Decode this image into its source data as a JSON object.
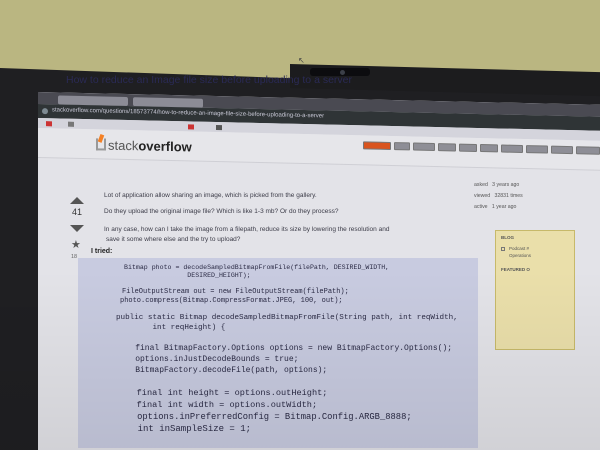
{
  "browser": {
    "url": "stackoverflow.com/questions/18573774/how-to-reduce-an-image-file-size-before-uploading-to-a-server"
  },
  "site": {
    "logo_prefix": "stack",
    "logo_suffix": "overflow"
  },
  "question": {
    "title": "How to reduce an Image file size before uploading to a server",
    "body_line_1": "Lot of application allow sharing an image, which is picked from the gallery.",
    "body_line_2": "Do they upload the original image file? Which is like 1-3 mb? Or do they process?",
    "body_line_3": "In any case, how can I take the image from a filepath, reduce its size by lowering the resolution and",
    "body_line_4": "save it some where else and the try to upload?",
    "tried_label": "I tried:",
    "votes": "41",
    "favorites": "18"
  },
  "meta": {
    "asked_label": "asked",
    "asked_value": "3 years ago",
    "viewed_label": "viewed",
    "viewed_value": "32831 times",
    "active_label": "active",
    "active_value": "1 year ago"
  },
  "code": [
    "Bitmap photo = decodeSampledBitmapFromFile(filePath, DESIRED_WIDTH,",
    "                DESIRED_HEIGHT);",
    "",
    "FileOutputStream out = new FileOutputStream(filePath);",
    "photo.compress(Bitmap.CompressFormat.JPEG, 100, out);",
    "",
    "public static Bitmap decodeSampledBitmapFromFile(String path, int reqWidth,",
    "        int reqHeight) {",
    "",
    "    final BitmapFactory.Options options = new BitmapFactory.Options();",
    "    options.inJustDecodeBounds = true;",
    "    BitmapFactory.decodeFile(path, options);",
    "",
    "    final int height = options.outHeight;",
    "    final int width = options.outWidth;",
    "    options.inPreferredConfig = Bitmap.Config.ARGB_8888;",
    "    int inSampleSize = 1;"
  ],
  "sidebar": {
    "blog_label": "BLOG",
    "item_1": "Podcast #",
    "item_2": "Operations",
    "featured_label": "FEATURED O"
  },
  "colors": {
    "brand_orange": "#f48024",
    "title_blue": "#2a2a55",
    "code_bg": "#c8cbe0",
    "sidebar_bg": "#eadfaa"
  }
}
